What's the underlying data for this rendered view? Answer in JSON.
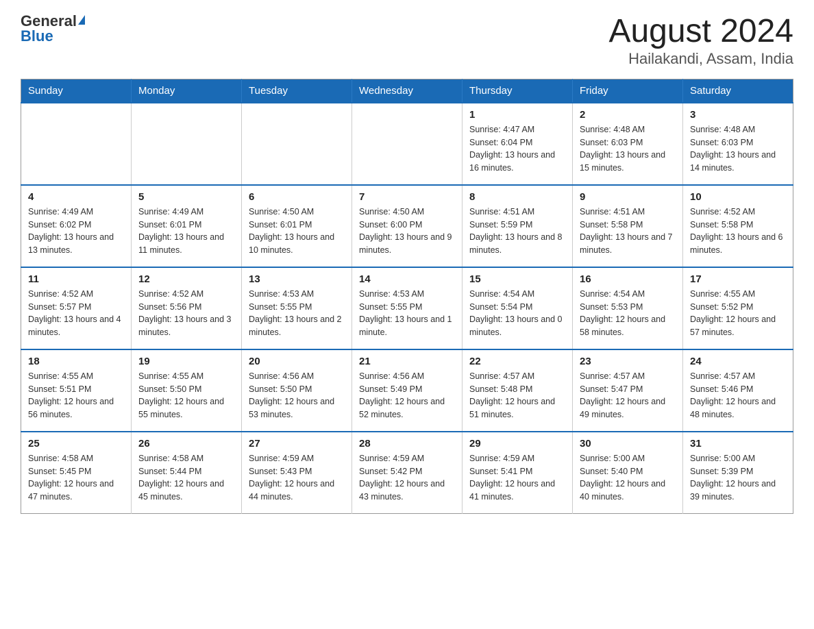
{
  "logo": {
    "general": "General",
    "blue": "Blue"
  },
  "title": "August 2024",
  "subtitle": "Hailakandi, Assam, India",
  "days_of_week": [
    "Sunday",
    "Monday",
    "Tuesday",
    "Wednesday",
    "Thursday",
    "Friday",
    "Saturday"
  ],
  "weeks": [
    [
      {
        "day": "",
        "sunrise": "",
        "sunset": "",
        "daylight": ""
      },
      {
        "day": "",
        "sunrise": "",
        "sunset": "",
        "daylight": ""
      },
      {
        "day": "",
        "sunrise": "",
        "sunset": "",
        "daylight": ""
      },
      {
        "day": "",
        "sunrise": "",
        "sunset": "",
        "daylight": ""
      },
      {
        "day": "1",
        "sunrise": "Sunrise: 4:47 AM",
        "sunset": "Sunset: 6:04 PM",
        "daylight": "Daylight: 13 hours and 16 minutes."
      },
      {
        "day": "2",
        "sunrise": "Sunrise: 4:48 AM",
        "sunset": "Sunset: 6:03 PM",
        "daylight": "Daylight: 13 hours and 15 minutes."
      },
      {
        "day": "3",
        "sunrise": "Sunrise: 4:48 AM",
        "sunset": "Sunset: 6:03 PM",
        "daylight": "Daylight: 13 hours and 14 minutes."
      }
    ],
    [
      {
        "day": "4",
        "sunrise": "Sunrise: 4:49 AM",
        "sunset": "Sunset: 6:02 PM",
        "daylight": "Daylight: 13 hours and 13 minutes."
      },
      {
        "day": "5",
        "sunrise": "Sunrise: 4:49 AM",
        "sunset": "Sunset: 6:01 PM",
        "daylight": "Daylight: 13 hours and 11 minutes."
      },
      {
        "day": "6",
        "sunrise": "Sunrise: 4:50 AM",
        "sunset": "Sunset: 6:01 PM",
        "daylight": "Daylight: 13 hours and 10 minutes."
      },
      {
        "day": "7",
        "sunrise": "Sunrise: 4:50 AM",
        "sunset": "Sunset: 6:00 PM",
        "daylight": "Daylight: 13 hours and 9 minutes."
      },
      {
        "day": "8",
        "sunrise": "Sunrise: 4:51 AM",
        "sunset": "Sunset: 5:59 PM",
        "daylight": "Daylight: 13 hours and 8 minutes."
      },
      {
        "day": "9",
        "sunrise": "Sunrise: 4:51 AM",
        "sunset": "Sunset: 5:58 PM",
        "daylight": "Daylight: 13 hours and 7 minutes."
      },
      {
        "day": "10",
        "sunrise": "Sunrise: 4:52 AM",
        "sunset": "Sunset: 5:58 PM",
        "daylight": "Daylight: 13 hours and 6 minutes."
      }
    ],
    [
      {
        "day": "11",
        "sunrise": "Sunrise: 4:52 AM",
        "sunset": "Sunset: 5:57 PM",
        "daylight": "Daylight: 13 hours and 4 minutes."
      },
      {
        "day": "12",
        "sunrise": "Sunrise: 4:52 AM",
        "sunset": "Sunset: 5:56 PM",
        "daylight": "Daylight: 13 hours and 3 minutes."
      },
      {
        "day": "13",
        "sunrise": "Sunrise: 4:53 AM",
        "sunset": "Sunset: 5:55 PM",
        "daylight": "Daylight: 13 hours and 2 minutes."
      },
      {
        "day": "14",
        "sunrise": "Sunrise: 4:53 AM",
        "sunset": "Sunset: 5:55 PM",
        "daylight": "Daylight: 13 hours and 1 minute."
      },
      {
        "day": "15",
        "sunrise": "Sunrise: 4:54 AM",
        "sunset": "Sunset: 5:54 PM",
        "daylight": "Daylight: 13 hours and 0 minutes."
      },
      {
        "day": "16",
        "sunrise": "Sunrise: 4:54 AM",
        "sunset": "Sunset: 5:53 PM",
        "daylight": "Daylight: 12 hours and 58 minutes."
      },
      {
        "day": "17",
        "sunrise": "Sunrise: 4:55 AM",
        "sunset": "Sunset: 5:52 PM",
        "daylight": "Daylight: 12 hours and 57 minutes."
      }
    ],
    [
      {
        "day": "18",
        "sunrise": "Sunrise: 4:55 AM",
        "sunset": "Sunset: 5:51 PM",
        "daylight": "Daylight: 12 hours and 56 minutes."
      },
      {
        "day": "19",
        "sunrise": "Sunrise: 4:55 AM",
        "sunset": "Sunset: 5:50 PM",
        "daylight": "Daylight: 12 hours and 55 minutes."
      },
      {
        "day": "20",
        "sunrise": "Sunrise: 4:56 AM",
        "sunset": "Sunset: 5:50 PM",
        "daylight": "Daylight: 12 hours and 53 minutes."
      },
      {
        "day": "21",
        "sunrise": "Sunrise: 4:56 AM",
        "sunset": "Sunset: 5:49 PM",
        "daylight": "Daylight: 12 hours and 52 minutes."
      },
      {
        "day": "22",
        "sunrise": "Sunrise: 4:57 AM",
        "sunset": "Sunset: 5:48 PM",
        "daylight": "Daylight: 12 hours and 51 minutes."
      },
      {
        "day": "23",
        "sunrise": "Sunrise: 4:57 AM",
        "sunset": "Sunset: 5:47 PM",
        "daylight": "Daylight: 12 hours and 49 minutes."
      },
      {
        "day": "24",
        "sunrise": "Sunrise: 4:57 AM",
        "sunset": "Sunset: 5:46 PM",
        "daylight": "Daylight: 12 hours and 48 minutes."
      }
    ],
    [
      {
        "day": "25",
        "sunrise": "Sunrise: 4:58 AM",
        "sunset": "Sunset: 5:45 PM",
        "daylight": "Daylight: 12 hours and 47 minutes."
      },
      {
        "day": "26",
        "sunrise": "Sunrise: 4:58 AM",
        "sunset": "Sunset: 5:44 PM",
        "daylight": "Daylight: 12 hours and 45 minutes."
      },
      {
        "day": "27",
        "sunrise": "Sunrise: 4:59 AM",
        "sunset": "Sunset: 5:43 PM",
        "daylight": "Daylight: 12 hours and 44 minutes."
      },
      {
        "day": "28",
        "sunrise": "Sunrise: 4:59 AM",
        "sunset": "Sunset: 5:42 PM",
        "daylight": "Daylight: 12 hours and 43 minutes."
      },
      {
        "day": "29",
        "sunrise": "Sunrise: 4:59 AM",
        "sunset": "Sunset: 5:41 PM",
        "daylight": "Daylight: 12 hours and 41 minutes."
      },
      {
        "day": "30",
        "sunrise": "Sunrise: 5:00 AM",
        "sunset": "Sunset: 5:40 PM",
        "daylight": "Daylight: 12 hours and 40 minutes."
      },
      {
        "day": "31",
        "sunrise": "Sunrise: 5:00 AM",
        "sunset": "Sunset: 5:39 PM",
        "daylight": "Daylight: 12 hours and 39 minutes."
      }
    ]
  ]
}
